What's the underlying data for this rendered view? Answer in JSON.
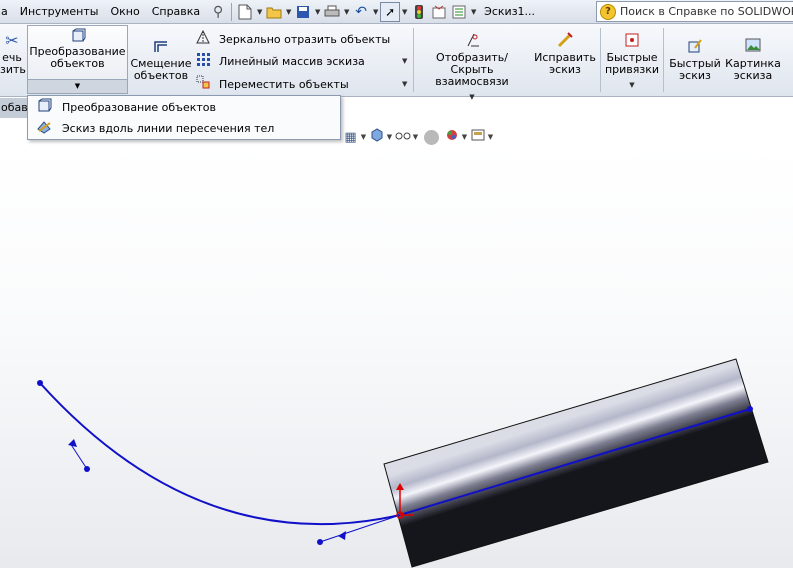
{
  "menubar": {
    "items": [
      "Инструменты",
      "Окно",
      "Справка"
    ],
    "cut_item": "а",
    "doc_title": "Эскиз1...",
    "search_placeholder": "Поиск в Справке по SOLIDWORKS"
  },
  "icons": {
    "pin": "pin-icon",
    "new": "new-document-icon",
    "open": "open-folder-icon",
    "save": "save-icon",
    "print": "print-icon",
    "undo": "undo-icon",
    "select": "select-cursor-icon",
    "rebuild": "traffic-light-icon",
    "file_props": "file-properties-icon",
    "options": "options-icon",
    "help": "help-question-icon"
  },
  "ribbon": {
    "cut_button": {
      "line1": "ечь",
      "line2": "зить"
    },
    "convert": {
      "line1": "Преобразование",
      "line2": "объектов"
    },
    "offset": {
      "line1": "Смещение",
      "line2": "объектов"
    },
    "mirror": "Зеркально отразить объекты",
    "linear_pattern": "Линейный массив эскиза",
    "move": "Переместить объекты",
    "relations": {
      "line1": "Отобразить/Скрыть",
      "line2": "взаимосвязи"
    },
    "repair": {
      "line1": "Исправить",
      "line2": "эскиз"
    },
    "snaps": {
      "line1": "Быстрые",
      "line2": "привязки"
    },
    "rapid_sketch": {
      "line1": "Быстрый",
      "line2": "эскиз"
    },
    "sketch_picture": {
      "line1": "Картинка",
      "line2": "эскиза"
    }
  },
  "tabstrip": {
    "label": "обав"
  },
  "dropdown": {
    "items": [
      {
        "label": "Преобразование объектов",
        "icon": "convert-entities-icon"
      },
      {
        "label": "Эскиз вдоль линии пересечения тел",
        "icon": "intersection-curve-icon"
      }
    ]
  },
  "colors": {
    "sketch": "#1010c8",
    "ribbon_bg": "#e6ebf2",
    "axis_red": "#e00000"
  }
}
